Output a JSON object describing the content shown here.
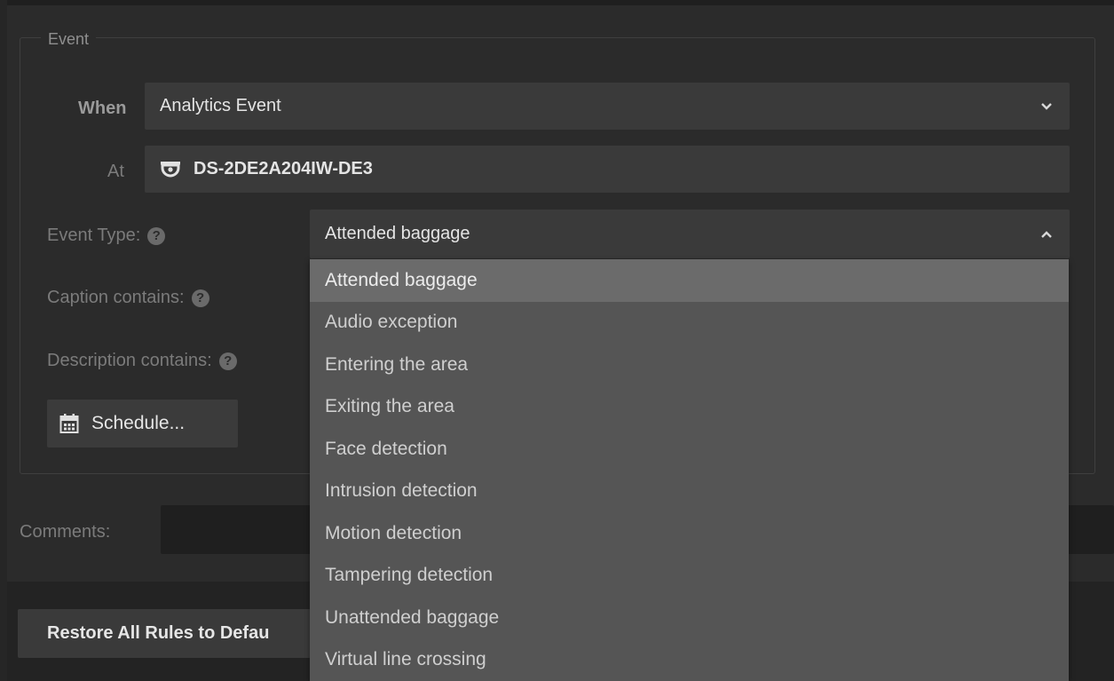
{
  "event_section": {
    "legend": "Event"
  },
  "when": {
    "label": "When",
    "value": "Analytics Event"
  },
  "at": {
    "label": "At",
    "device_icon": "camera-dome-icon",
    "value": "DS-2DE2A204IW-DE3"
  },
  "event_type": {
    "label": "Event Type:",
    "value": "Attended baggage",
    "options": [
      "Attended baggage",
      "Audio exception",
      "Entering the area",
      "Exiting the area",
      "Face detection",
      "Intrusion detection",
      "Motion detection",
      "Tampering detection",
      "Unattended baggage",
      "Virtual line crossing"
    ],
    "selected_index": 0
  },
  "caption": {
    "label": "Caption contains:"
  },
  "description": {
    "label": "Description contains:"
  },
  "help_glyph": "?",
  "schedule": {
    "label": "Schedule...",
    "icon": "calendar-icon"
  },
  "comments": {
    "label": "Comments:",
    "value": ""
  },
  "restore": {
    "label": "Restore All Rules to Defau"
  },
  "colors": {
    "background": "#2b2b2b",
    "field": "#3a3a3a",
    "dropdown": "#555555",
    "dropdown_selected": "#6b6b6b"
  }
}
